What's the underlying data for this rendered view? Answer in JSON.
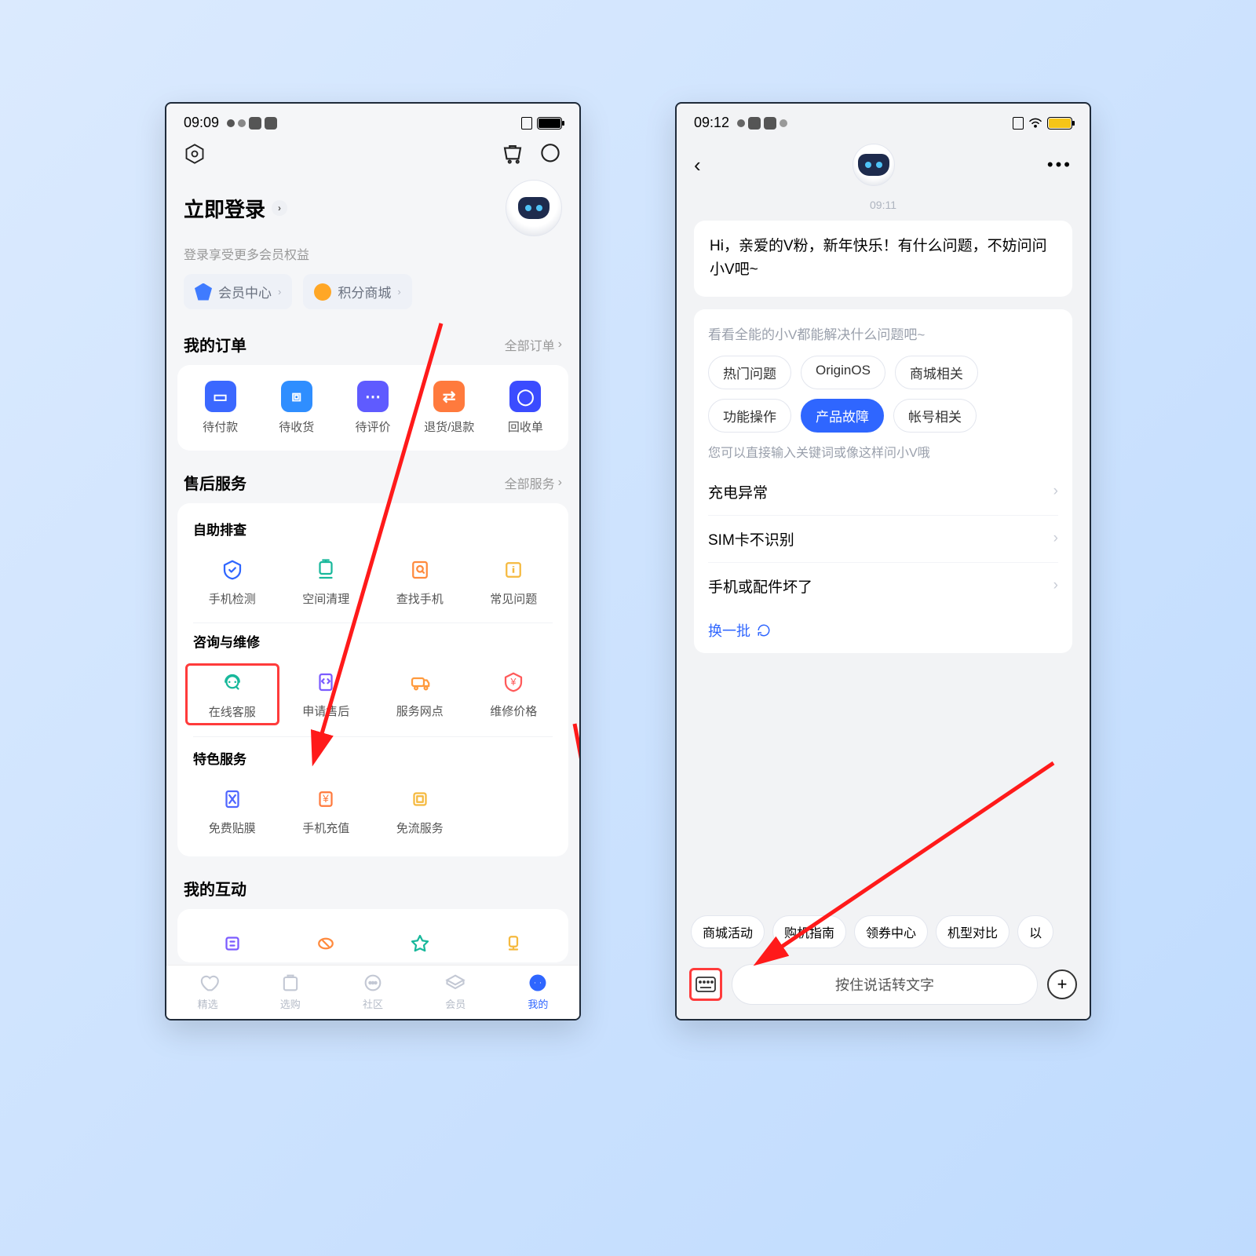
{
  "left": {
    "status_time": "09:09",
    "login_title": "立即登录",
    "login_sub": "登录享受更多会员权益",
    "chips": {
      "vip": "会员中心",
      "points": "积分商城"
    },
    "orders": {
      "title": "我的订单",
      "all": "全部订单",
      "items": [
        "待付款",
        "待收货",
        "待评价",
        "退货/退款",
        "回收单"
      ]
    },
    "service": {
      "title": "售后服务",
      "all": "全部服务",
      "self": "自助排查",
      "self_items": [
        "手机检测",
        "空间清理",
        "查找手机",
        "常见问题"
      ],
      "consult": "咨询与维修",
      "consult_items": [
        "在线客服",
        "申请售后",
        "服务网点",
        "维修价格"
      ],
      "special": "特色服务",
      "special_items": [
        "免费贴膜",
        "手机充值",
        "免流服务"
      ]
    },
    "interact_title": "我的互动",
    "nav": [
      "精选",
      "选购",
      "社区",
      "会员",
      "我的"
    ]
  },
  "right": {
    "status_time": "09:12",
    "timestamp": "09:11",
    "greeting": "Hi，亲爱的V粉，新年快乐！有什么问题，不妨问问小V吧~",
    "help_title": "看看全能的小V都能解决什么问题吧~",
    "categories": [
      "热门问题",
      "OriginOS",
      "商城相关",
      "功能操作",
      "产品故障",
      "帐号相关"
    ],
    "active_category": "产品故障",
    "keyword_hint": "您可以直接输入关键词或像这样问小V哦",
    "qa": [
      "充电异常",
      "SIM卡不识别",
      "手机或配件坏了"
    ],
    "refresh": "换一批",
    "suggests": [
      "商城活动",
      "购机指南",
      "领券中心",
      "机型对比",
      "以"
    ],
    "voice_placeholder": "按住说话转文字"
  }
}
